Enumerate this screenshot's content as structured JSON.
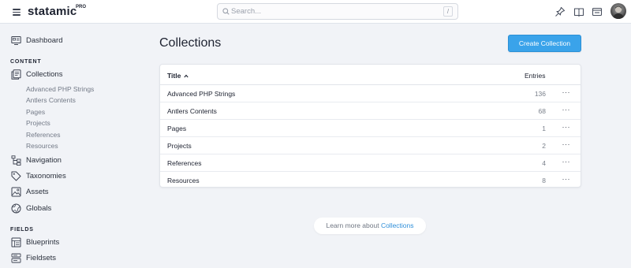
{
  "topbar": {
    "brand": "statamic",
    "brand_badge": "PRO",
    "search_placeholder": "Search...",
    "search_shortcut": "/",
    "icons": [
      "pin-icon",
      "book-icon",
      "site-icon"
    ]
  },
  "sidebar": {
    "dashboard_label": "Dashboard",
    "content_section": "CONTENT",
    "collections_label": "Collections",
    "collection_links": [
      "Advanced PHP Strings",
      "Antlers Contents",
      "Pages",
      "Projects",
      "References",
      "Resources"
    ],
    "navigation_label": "Navigation",
    "taxonomies_label": "Taxonomies",
    "assets_label": "Assets",
    "globals_label": "Globals",
    "fields_section": "FIELDS",
    "blueprints_label": "Blueprints",
    "fieldsets_label": "Fieldsets"
  },
  "main": {
    "title": "Collections",
    "create_button": "Create Collection",
    "table": {
      "col_title": "Title",
      "col_entries": "Entries",
      "rows": [
        {
          "title": "Advanced PHP Strings",
          "entries": "136"
        },
        {
          "title": "Antlers Contents",
          "entries": "68"
        },
        {
          "title": "Pages",
          "entries": "1"
        },
        {
          "title": "Projects",
          "entries": "2"
        },
        {
          "title": "References",
          "entries": "4"
        },
        {
          "title": "Resources",
          "entries": "8"
        }
      ],
      "row_menu": "···"
    },
    "learn_more_prefix": "Learn more about ",
    "learn_more_link": "Collections"
  },
  "colors": {
    "accent": "#3aa3ea",
    "link": "#2f8fd9",
    "background": "#f1f3f7"
  }
}
